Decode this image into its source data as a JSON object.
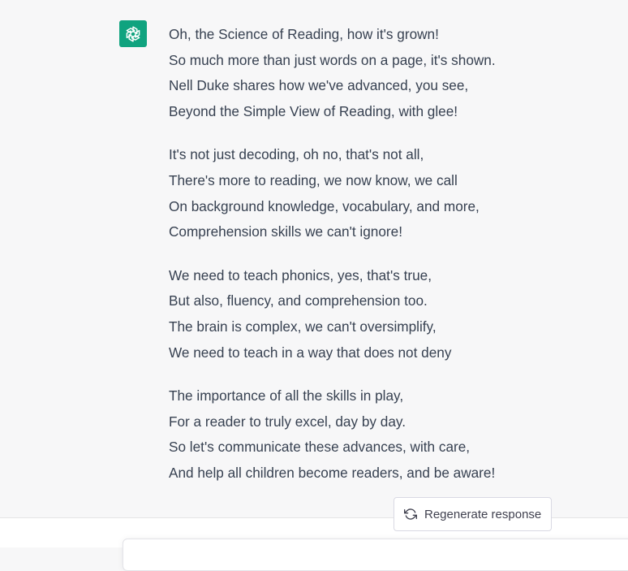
{
  "message": {
    "avatar_icon": "openai-logo-icon",
    "stanzas": [
      {
        "lines": [
          "Oh, the Science of Reading, how it's grown!",
          "So much more than just words on a page, it's shown.",
          "Nell Duke shares how we've advanced, you see,",
          "Beyond the Simple View of Reading, with glee!"
        ]
      },
      {
        "lines": [
          "It's not just decoding, oh no, that's not all,",
          "There's more to reading, we now know, we call",
          "On background knowledge, vocabulary, and more,",
          "Comprehension skills we can't ignore!"
        ]
      },
      {
        "lines": [
          "We need to teach phonics, yes, that's true,",
          "But also, fluency, and comprehension too.",
          "The brain is complex, we can't oversimplify,",
          "We need to teach in a way that does not deny"
        ]
      },
      {
        "lines": [
          "The importance of all the skills in play,",
          "For a reader to truly excel, day by day.",
          "So let's communicate these advances, with care,",
          "And help all children become readers, and be aware!"
        ]
      }
    ]
  },
  "regenerate": {
    "label": "Regenerate response",
    "icon": "refresh-icon"
  },
  "colors": {
    "avatar_bg": "#10a37f",
    "message_bg": "#f7f7f8",
    "text": "#374151"
  }
}
